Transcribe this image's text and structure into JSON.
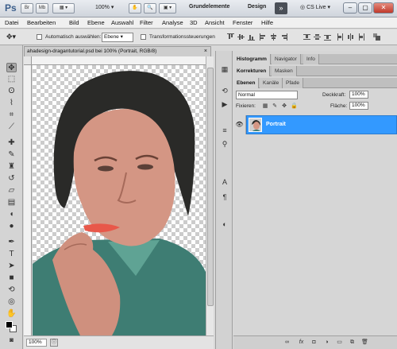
{
  "appbar": {
    "logo": "Ps",
    "bridge_label": "Br",
    "minibridge_label": "Mb",
    "zoom_value": "100%",
    "workspace_active": "Grundelemente",
    "workspace_other": "Design",
    "forward_label": "»",
    "cslive_label": "CS Live"
  },
  "menubar": {
    "items": [
      "Datei",
      "Bearbeiten",
      "Bild",
      "Ebene",
      "Auswahl",
      "Filter",
      "Analyse",
      "3D",
      "Ansicht",
      "Fenster",
      "Hilfe"
    ]
  },
  "optionsbar": {
    "auto_select_label": "Automatisch auswählen:",
    "auto_select_value": "Ebene",
    "transform_label": "Transformationssteuerungen"
  },
  "document": {
    "tab_title": "ahadesign-dragantutorial.psd bei 100% (Portrait, RGB/8)",
    "close_glyph": "×",
    "zoom_status": "100%"
  },
  "panels": {
    "group1_tabs": [
      "Histogramm",
      "Navigator",
      "Info"
    ],
    "group2_tabs": [
      "Korrekturen",
      "Masken"
    ],
    "group3_tabs": [
      "Ebenen",
      "Kanäle",
      "Pfade"
    ],
    "blend_mode": "Normal",
    "opacity_label": "Deckkraft:",
    "opacity_value": "100%",
    "lock_label": "Fixieren:",
    "fill_label": "Fläche:",
    "fill_value": "100%",
    "layer_name": "Portrait"
  },
  "colors": {
    "layer_selected": "#3399ff",
    "close_button": "#c0392b"
  }
}
